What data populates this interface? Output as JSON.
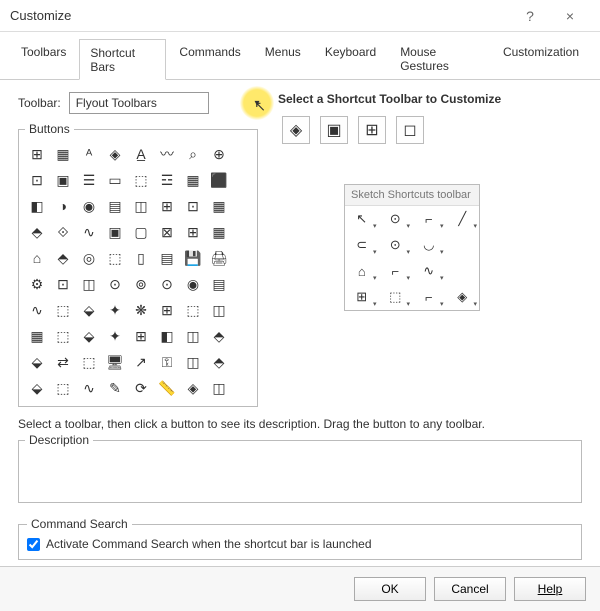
{
  "window": {
    "title": "Customize",
    "help": "?",
    "close": "×"
  },
  "tabs": [
    "Toolbars",
    "Shortcut Bars",
    "Commands",
    "Menus",
    "Keyboard",
    "Mouse Gestures",
    "Customization"
  ],
  "active_tab": "Shortcut Bars",
  "toolbar_label": "Toolbar:",
  "toolbar_value": "Flyout Toolbars",
  "buttons_legend": "Buttons",
  "select_label": "Select a Shortcut Toolbar to Customize",
  "sketch_title": "Sketch Shortcuts toolbar",
  "hint": "Select a toolbar, then click a button to see its description. Drag the button to any toolbar.",
  "description_legend": "Description",
  "cs_legend": "Command Search",
  "cs_checkbox": "Activate Command Search when the shortcut bar is launched",
  "cs_checked": true,
  "footer": {
    "ok": "OK",
    "cancel": "Cancel",
    "help": "Help"
  },
  "button_icons": [
    "⊞",
    "▦",
    "ᴬ",
    "◈",
    "A̲",
    "〰",
    "⌕",
    "⊕",
    "⊡",
    "▣",
    "☰",
    "▭",
    "⬚",
    "☲",
    "▦",
    "⬛",
    "◧",
    "◑",
    "◉",
    "▤",
    "◫",
    "⊞",
    "⊡",
    "▦",
    "⬘",
    "⟐",
    "∿",
    "▣",
    "▢",
    "⊠",
    "⊞",
    "▦",
    "⌂",
    "⬘",
    "◎",
    "⬚",
    "▯",
    "▤",
    "💾",
    "🖨",
    "⚙",
    "⊡",
    "◫",
    "⊙",
    "⊚",
    "⊙",
    "◉",
    "▤",
    "∿",
    "⬚",
    "⬙",
    "✦",
    "❋",
    "⊞",
    "⬚",
    "◫",
    "▦",
    "⬚",
    "⬙",
    "✦",
    "⊞",
    "◧",
    "◫",
    "⬘",
    "⬙",
    "⇄",
    "⬚",
    "🖥",
    "↗",
    "⚿",
    "◫",
    "⬘",
    "⬙",
    "⬚",
    "∿",
    "✎",
    "⟳",
    "📏",
    "◈",
    "◫"
  ],
  "target_icons": [
    "◈",
    "▣",
    "⊞",
    "◻"
  ],
  "sketch_icons": [
    "↖",
    "⊙",
    "⌐",
    "╱",
    "⊂",
    "⊙",
    "◡",
    "",
    "⌂",
    "⌐",
    "∿",
    "",
    "⊞",
    "⬚",
    "⌐",
    "◈"
  ]
}
